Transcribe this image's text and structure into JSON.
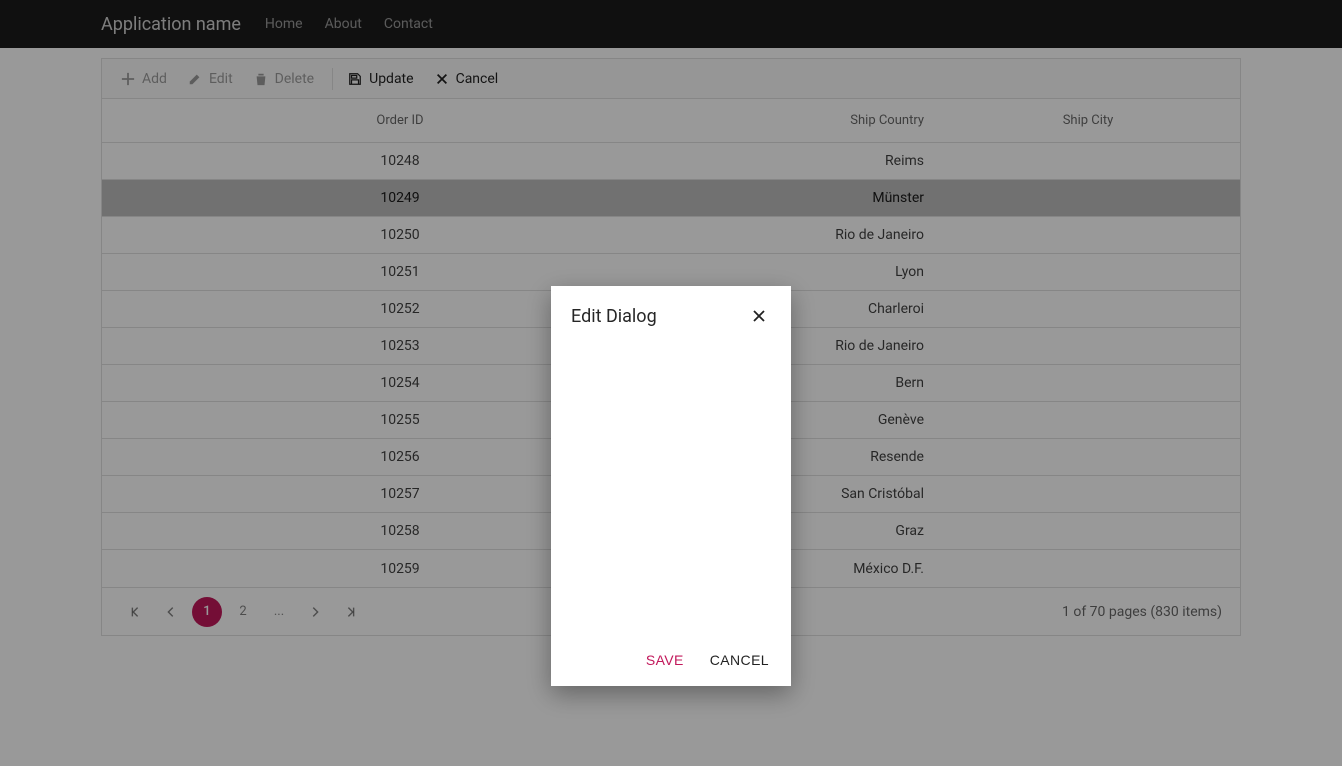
{
  "accent": "#c2185b",
  "navbar": {
    "brand": "Application name",
    "items": [
      "Home",
      "About",
      "Contact"
    ]
  },
  "toolbar": {
    "add": "Add",
    "edit": "Edit",
    "delete": "Delete",
    "update": "Update",
    "cancel": "Cancel"
  },
  "columns": {
    "order_id": "Order ID",
    "ship_country": "Ship Country",
    "ship_city": "Ship City"
  },
  "rows": [
    {
      "id": "10248",
      "country": "Reims",
      "city": ""
    },
    {
      "id": "10249",
      "country": "Münster",
      "city": ""
    },
    {
      "id": "10250",
      "country": "Rio de Janeiro",
      "city": ""
    },
    {
      "id": "10251",
      "country": "Lyon",
      "city": ""
    },
    {
      "id": "10252",
      "country": "Charleroi",
      "city": ""
    },
    {
      "id": "10253",
      "country": "Rio de Janeiro",
      "city": ""
    },
    {
      "id": "10254",
      "country": "Bern",
      "city": ""
    },
    {
      "id": "10255",
      "country": "Genève",
      "city": ""
    },
    {
      "id": "10256",
      "country": "Resende",
      "city": ""
    },
    {
      "id": "10257",
      "country": "San Cristóbal",
      "city": ""
    },
    {
      "id": "10258",
      "country": "Graz",
      "city": ""
    },
    {
      "id": "10259",
      "country": "México D.F.",
      "city": ""
    }
  ],
  "selected_row_index": 1,
  "pager": {
    "pages": [
      "1",
      "2",
      "..."
    ],
    "active_index": 0,
    "info": "1 of 70 pages (830 items)"
  },
  "dialog": {
    "title": "Edit Dialog",
    "save": "SAVE",
    "cancel": "CANCEL"
  }
}
